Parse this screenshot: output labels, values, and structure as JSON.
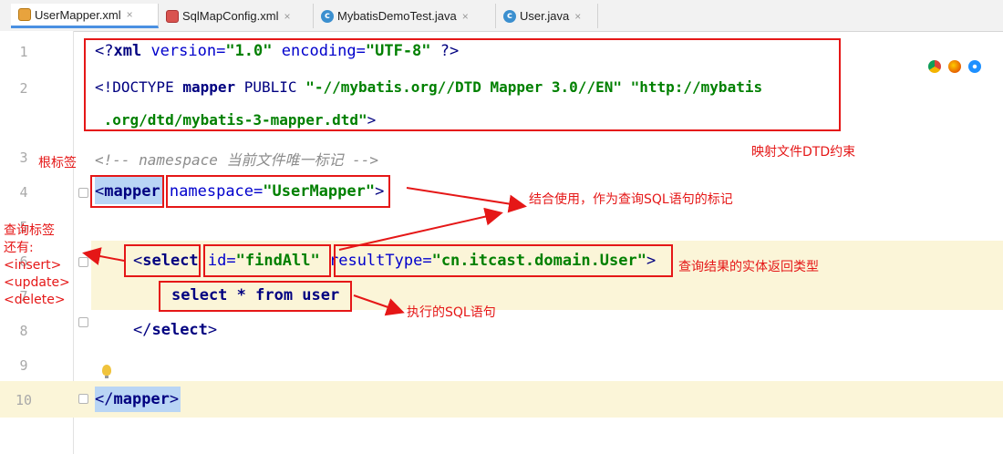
{
  "tabs": [
    {
      "label": "UserMapper.xml",
      "active": true,
      "icon": "xml-file-icon"
    },
    {
      "label": "SqlMapConfig.xml",
      "active": false,
      "icon": "xml-file-icon"
    },
    {
      "label": "MybatisDemoTest.java",
      "active": false,
      "icon": "class-icon"
    },
    {
      "label": "User.java",
      "active": false,
      "icon": "class-icon"
    }
  ],
  "close_glyph": "×",
  "line_numbers": [
    "1",
    "2",
    "3",
    "4",
    "5",
    "6",
    "7",
    "8",
    "9",
    "10"
  ],
  "code": {
    "l1": {
      "open": "<?",
      "kw": "xml",
      "a1": " version=",
      "v1": "\"1.0\"",
      "a2": " encoding=",
      "v2": "\"UTF-8\"",
      "close": " ?>"
    },
    "l2": {
      "open": "<!DOCTYPE ",
      "name": "mapper",
      "mid": " PUBLIC ",
      "s1": "\"-//mybatis.org//DTD Mapper 3.0//EN\"",
      "s2a": " \"http://mybatis"
    },
    "l2b": {
      "s2b": " .org/dtd/mybatis-3-mapper.dtd\"",
      "close": ">"
    },
    "l3": {
      "comment": "<!-- namespace 当前文件唯一标记 -->"
    },
    "l4": {
      "open": "<",
      "name": "mapper",
      "attr": " namespace=",
      "val": "\"UserMapper\"",
      "close": ">"
    },
    "l6": {
      "open": "<",
      "name": "select",
      "a1": " id=",
      "v1": "\"findAll\"",
      "a2": " resultType=",
      "v2": "\"cn.itcast.domain.User\"",
      "close": ">"
    },
    "l7": {
      "sql": "select * from user"
    },
    "l8": {
      "close": "</",
      "name": "select",
      "end": ">"
    },
    "l10": {
      "close": "</",
      "name": "mapper",
      "end": ">"
    }
  },
  "annotations": {
    "dtd": "映射文件DTD约束",
    "root": "根标签",
    "namespace": "结合使用，作为查询SQL语句的标记",
    "query_tags": [
      "查询标签",
      "还有:",
      "<insert>",
      "<update>",
      "<delete>"
    ],
    "result_type": "查询结果的实体返回类型",
    "sql": "执行的SQL语句"
  },
  "colors": {
    "annotation": "#e51717",
    "tag": "#000080",
    "string": "#008000",
    "active_tab_underline": "#4a90e2"
  },
  "browser_icons": [
    "chrome-icon",
    "firefox-icon",
    "safari-icon"
  ]
}
